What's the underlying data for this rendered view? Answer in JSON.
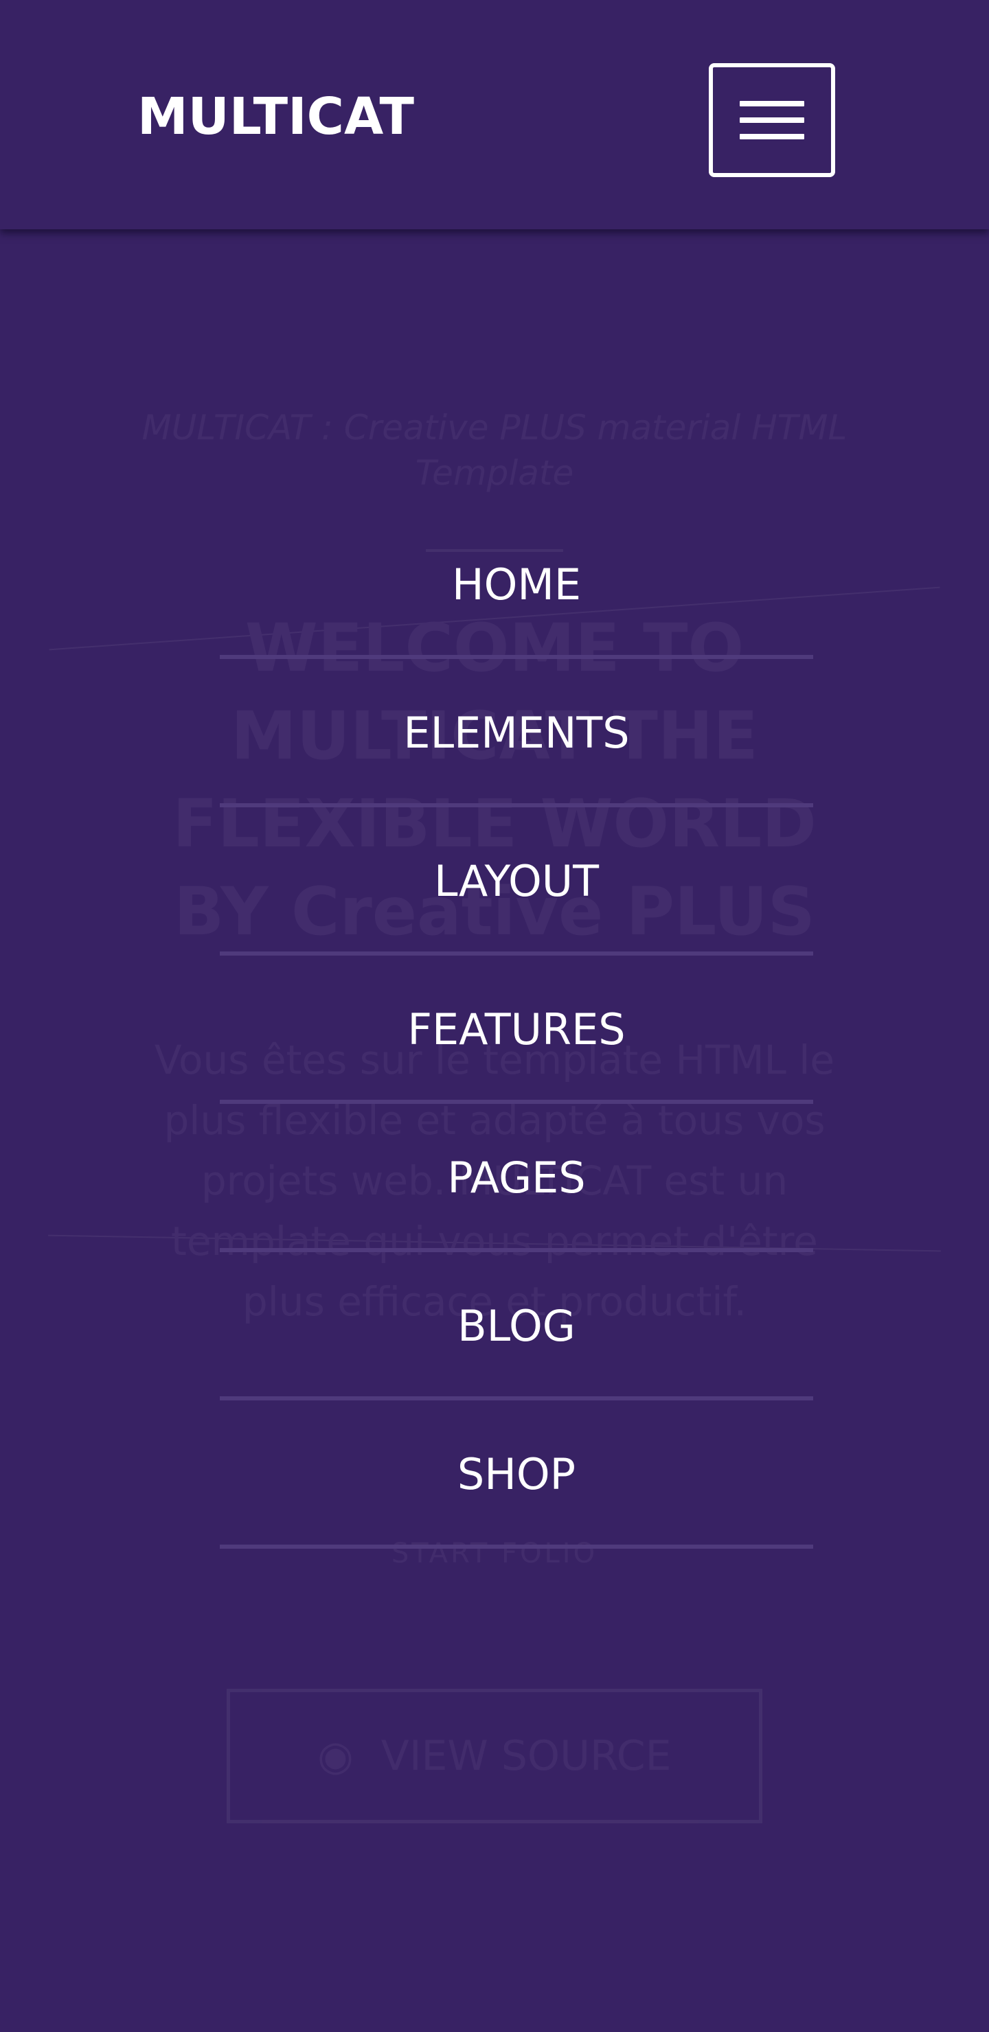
{
  "header": {
    "brand": "MULTICAT",
    "menu_icon": "hamburger-icon"
  },
  "nav": {
    "items": [
      {
        "label": "HOME"
      },
      {
        "label": "ELEMENTS"
      },
      {
        "label": "LAYOUT"
      },
      {
        "label": "FEATURES"
      },
      {
        "label": "PAGES"
      },
      {
        "label": "BLOG"
      },
      {
        "label": "SHOP"
      }
    ]
  },
  "hero": {
    "subtitle": "MULTICAT : Creative PLUS material HTML Template",
    "title": "WELCOME TO MULTICAT THE FLEXIBLE WORLD BY Creative PLUS",
    "description": "Vous êtes sur le template HTML le plus flexible et adapté à tous vos projets web. MULTICAT est un template qui vous permet d'être plus efficace et productif.",
    "small_label": "START FOLIO",
    "button_label": "VIEW SOURCE",
    "button_icon": "github-icon"
  },
  "colors": {
    "background": "#382264",
    "divider": "#4f3a7c",
    "text": "#ffffff"
  }
}
